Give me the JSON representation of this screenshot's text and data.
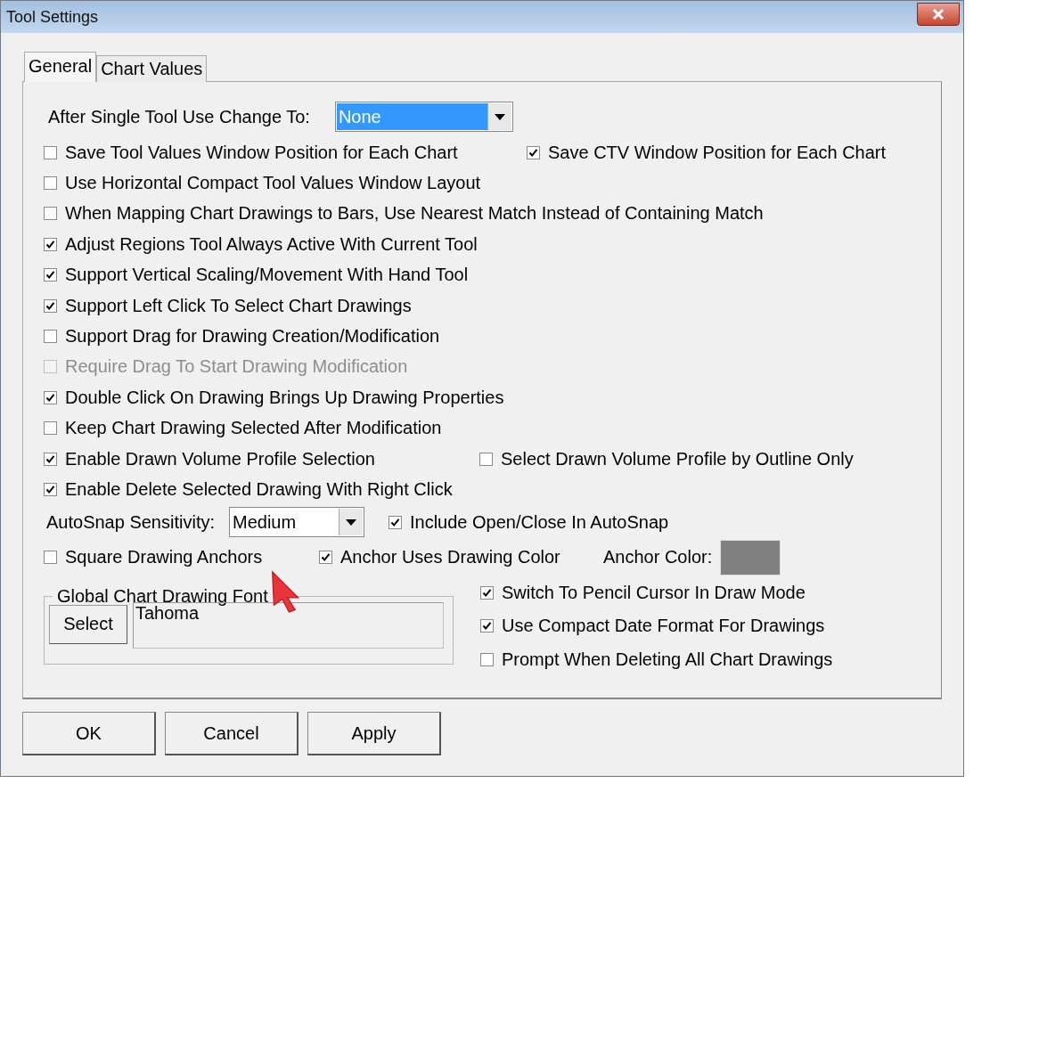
{
  "window": {
    "title": "Tool Settings"
  },
  "tabs": [
    {
      "label": "General",
      "selected": true
    },
    {
      "label": "Chart Values",
      "selected": false
    }
  ],
  "change_to": {
    "label": "After Single Tool Use Change To:",
    "value": "None",
    "highlighted": true
  },
  "options": [
    {
      "items": [
        {
          "label": "Save Tool Values Window Position for Each Chart",
          "checked": false,
          "disabled": false
        },
        {
          "label": "Save CTV Window Position for Each Chart",
          "checked": true,
          "disabled": false
        }
      ]
    },
    {
      "items": [
        {
          "label": "Use Horizontal Compact Tool Values Window Layout",
          "checked": false,
          "disabled": false
        }
      ]
    },
    {
      "items": [
        {
          "label": "When Mapping Chart Drawings to Bars, Use Nearest Match Instead of Containing Match",
          "checked": false,
          "disabled": false
        }
      ]
    },
    {
      "items": [
        {
          "label": "Adjust Regions Tool Always Active With Current Tool",
          "checked": true,
          "disabled": false
        }
      ]
    },
    {
      "items": [
        {
          "label": "Support Vertical Scaling/Movement With Hand Tool",
          "checked": true,
          "disabled": false
        }
      ]
    },
    {
      "items": [
        {
          "label": "Support Left Click To Select Chart Drawings",
          "checked": true,
          "disabled": false
        }
      ]
    },
    {
      "items": [
        {
          "label": "Support Drag for Drawing Creation/Modification",
          "checked": false,
          "disabled": false
        }
      ]
    },
    {
      "items": [
        {
          "label": "Require Drag To Start Drawing Modification",
          "checked": false,
          "disabled": true
        }
      ]
    },
    {
      "items": [
        {
          "label": "Double Click On Drawing Brings Up Drawing Properties",
          "checked": true,
          "disabled": false
        }
      ]
    },
    {
      "items": [
        {
          "label": "Keep Chart Drawing Selected After Modification",
          "checked": false,
          "disabled": false
        }
      ]
    },
    {
      "items": [
        {
          "label": "Enable Drawn Volume Profile Selection",
          "checked": true,
          "disabled": false
        },
        {
          "label": "Select Drawn Volume Profile by Outline Only",
          "checked": false,
          "disabled": false
        }
      ]
    },
    {
      "items": [
        {
          "label": "Enable Delete Selected Drawing With Right Click",
          "checked": true,
          "disabled": false
        }
      ]
    }
  ],
  "autosnap": {
    "label": "AutoSnap Sensitivity:",
    "value": "Medium"
  },
  "include_open_close": {
    "label": "Include Open/Close In AutoSnap",
    "checked": true
  },
  "anchor_options": [
    {
      "label": "Square Drawing Anchors",
      "checked": false
    },
    {
      "label": "Anchor Uses Drawing Color",
      "checked": true
    }
  ],
  "anchor_color": {
    "label": "Anchor Color:",
    "color": "#808080"
  },
  "font_group": {
    "title": "Global Chart Drawing Font",
    "button": "Select",
    "value": "Tahoma"
  },
  "draw_options": [
    {
      "label": "Switch To Pencil Cursor In Draw Mode",
      "checked": true
    },
    {
      "label": "Use Compact Date Format For Drawings",
      "checked": true
    },
    {
      "label": "Prompt When Deleting All Chart Drawings",
      "checked": false
    }
  ],
  "buttons": [
    "OK",
    "Cancel",
    "Apply"
  ]
}
